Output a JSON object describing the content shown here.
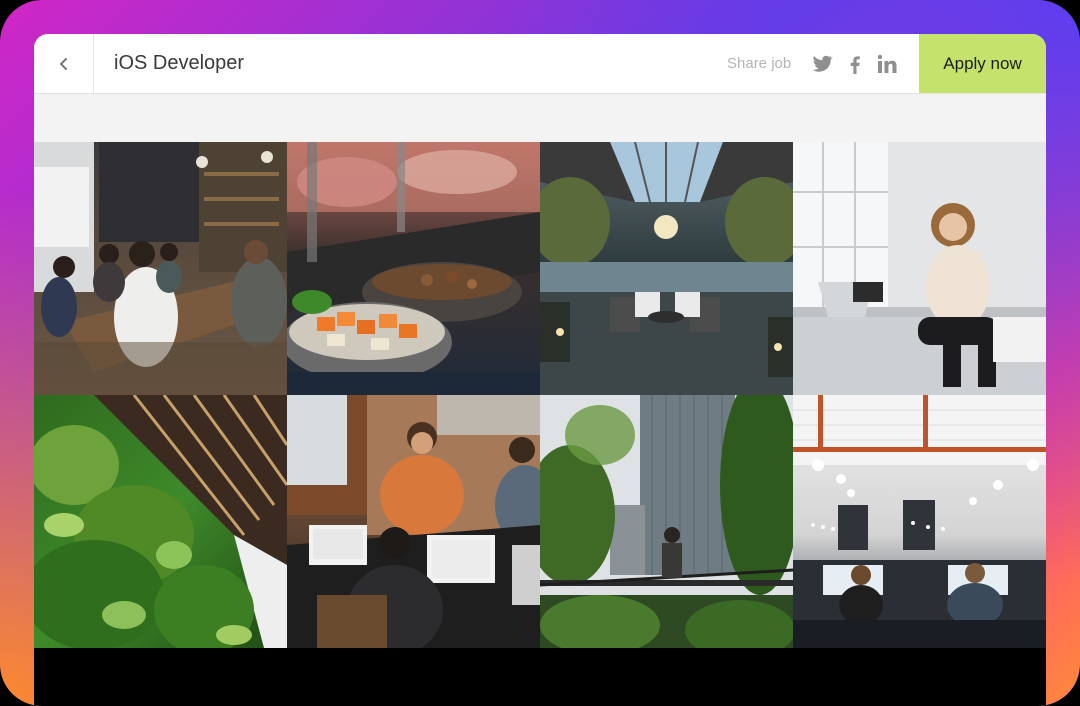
{
  "header": {
    "title": "iOS Developer",
    "share_label": "Share job",
    "apply_label": "Apply now",
    "back_icon": "chevron-left-icon",
    "social_icons": [
      "twitter-icon",
      "facebook-icon",
      "linkedin-icon"
    ]
  },
  "gallery": {
    "photos": [
      "cafe-team-meeting-photo",
      "food-buffet-photo",
      "atrium-lounge-photo",
      "woman-working-window-photo",
      "living-plant-wall-photo",
      "coworkers-laptops-photo",
      "city-rooftop-photo",
      "open-office-photo"
    ]
  },
  "colors": {
    "apply_bg": "#c5e36c",
    "frame_gradient": [
      "#d026c6",
      "#6a3be0",
      "#ff3d8a",
      "#ff8a3a"
    ]
  }
}
